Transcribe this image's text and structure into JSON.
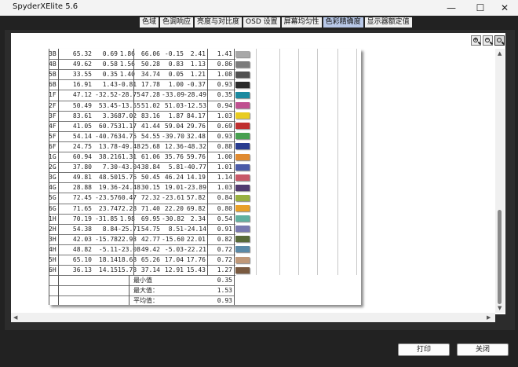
{
  "app": {
    "title": "SpyderXElite 5.6"
  },
  "window": {
    "minimize": "—",
    "maximize": "☐",
    "close": "✕"
  },
  "tabs": [
    {
      "label": "色域",
      "active": false
    },
    {
      "label": "色调响应",
      "active": false
    },
    {
      "label": "亮度与对比度",
      "active": false
    },
    {
      "label": "OSD 设置",
      "active": false
    },
    {
      "label": "屏幕均匀性",
      "active": false
    },
    {
      "label": "色彩精确度",
      "active": true
    },
    {
      "label": "显示器额定值",
      "active": false
    }
  ],
  "zoom": [
    "zoom-in-icon",
    "zoom-out-icon",
    "zoom-fit-icon"
  ],
  "table": {
    "rows": [
      {
        "id": "3B",
        "a": [
          "65.32",
          "0.69",
          "1.86"
        ],
        "b": [
          "66.06",
          "-0.15",
          "2.41"
        ],
        "de": "1.41",
        "color": "#a8a8a8"
      },
      {
        "id": "4B",
        "a": [
          "49.62",
          "0.58",
          "1.56"
        ],
        "b": [
          "50.28",
          "0.83",
          "1.13"
        ],
        "de": "0.86",
        "color": "#7c7c7c"
      },
      {
        "id": "5B",
        "a": [
          "33.55",
          "0.35",
          "1.40"
        ],
        "b": [
          "34.74",
          "0.05",
          "1.21"
        ],
        "de": "1.08",
        "color": "#505050"
      },
      {
        "id": "6B",
        "a": [
          "16.91",
          "1.43",
          "-0.81"
        ],
        "b": [
          "17.78",
          "1.00",
          "-0.37"
        ],
        "de": "0.93",
        "color": "#2a2a2a"
      },
      {
        "id": "1F",
        "a": [
          "47.12",
          "-32.52",
          "-28.75"
        ],
        "b": [
          "47.28",
          "-33.09",
          "-28.49"
        ],
        "de": "0.35",
        "color": "#1c8aa0"
      },
      {
        "id": "2F",
        "a": [
          "50.49",
          "53.45",
          "-13.55"
        ],
        "b": [
          "51.02",
          "51.03",
          "-12.53"
        ],
        "de": "0.94",
        "color": "#c05090"
      },
      {
        "id": "3F",
        "a": [
          "83.61",
          "3.36",
          "87.02"
        ],
        "b": [
          "83.16",
          "1.87",
          "84.17"
        ],
        "de": "1.03",
        "color": "#e8cc20"
      },
      {
        "id": "4F",
        "a": [
          "41.05",
          "60.75",
          "31.17"
        ],
        "b": [
          "41.44",
          "59.04",
          "29.76"
        ],
        "de": "0.69",
        "color": "#c03030"
      },
      {
        "id": "5F",
        "a": [
          "54.14",
          "-40.76",
          "34.75"
        ],
        "b": [
          "54.55",
          "-39.70",
          "32.48"
        ],
        "de": "0.93",
        "color": "#48a050"
      },
      {
        "id": "6F",
        "a": [
          "24.75",
          "13.78",
          "-49.48"
        ],
        "b": [
          "25.68",
          "12.36",
          "-48.32"
        ],
        "de": "0.88",
        "color": "#283c90"
      },
      {
        "id": "1G",
        "a": [
          "60.94",
          "38.21",
          "61.31"
        ],
        "b": [
          "61.06",
          "35.76",
          "59.76"
        ],
        "de": "1.00",
        "color": "#e08a30"
      },
      {
        "id": "2G",
        "a": [
          "37.80",
          "7.30",
          "-43.04"
        ],
        "b": [
          "38.84",
          "5.81",
          "-40.77"
        ],
        "de": "1.01",
        "color": "#4a5aa8"
      },
      {
        "id": "3G",
        "a": [
          "49.81",
          "48.50",
          "15.76"
        ],
        "b": [
          "50.45",
          "46.24",
          "14.19"
        ],
        "de": "1.14",
        "color": "#c85868"
      },
      {
        "id": "4G",
        "a": [
          "28.88",
          "19.36",
          "-24.48"
        ],
        "b": [
          "30.15",
          "19.01",
          "-23.89"
        ],
        "de": "1.03",
        "color": "#503a70"
      },
      {
        "id": "5G",
        "a": [
          "72.45",
          "-23.57",
          "60.47"
        ],
        "b": [
          "72.32",
          "-23.61",
          "57.82"
        ],
        "de": "0.84",
        "color": "#98b040"
      },
      {
        "id": "6G",
        "a": [
          "71.65",
          "23.74",
          "72.28"
        ],
        "b": [
          "71.40",
          "22.20",
          "69.82"
        ],
        "de": "0.80",
        "color": "#e8a028"
      },
      {
        "id": "1H",
        "a": [
          "70.19",
          "-31.85",
          "1.98"
        ],
        "b": [
          "69.95",
          "-30.82",
          "2.34",
          ""
        ],
        "de": "0.54",
        "color": "#60b0a0"
      },
      {
        "id": "2H",
        "a": [
          "54.38",
          "8.84",
          "-25.71"
        ],
        "b": [
          "54.75",
          "8.51",
          "-24.14"
        ],
        "de": "0.91",
        "color": "#7878b0"
      },
      {
        "id": "3H",
        "a": [
          "42.03",
          "-15.78",
          "22.93"
        ],
        "b": [
          "42.77",
          "-15.60",
          "22.01"
        ],
        "de": "0.82",
        "color": "#586a38"
      },
      {
        "id": "4H",
        "a": [
          "48.82",
          "-5.11",
          "-23.08"
        ],
        "b": [
          "49.42",
          "-5.03",
          "-22.21"
        ],
        "de": "0.72",
        "color": "#5a8aa8"
      },
      {
        "id": "5H",
        "a": [
          "65.10",
          "18.14",
          "18.68"
        ],
        "b": [
          "65.26",
          "17.04",
          "17.76"
        ],
        "de": "0.72",
        "color": "#c09878"
      },
      {
        "id": "6H",
        "a": [
          "36.13",
          "14.15",
          "15.78"
        ],
        "b": [
          "37.14",
          "12.91",
          "15.43"
        ],
        "de": "1.27",
        "color": "#7a5a40"
      }
    ],
    "summary": [
      {
        "label": "最小值",
        "value": "0.35"
      },
      {
        "label": "最大值：",
        "value": "1.53"
      },
      {
        "label": "平均值：",
        "value": "0.93"
      }
    ]
  },
  "footer": {
    "print": "打印",
    "close": "关闭"
  }
}
